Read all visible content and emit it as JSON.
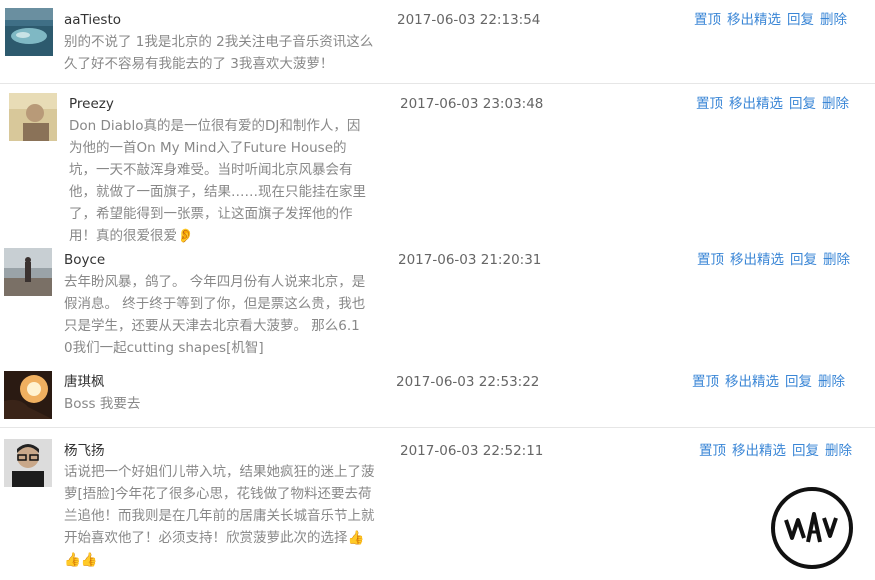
{
  "actions": {
    "pin": "置顶",
    "unfeature": "移出精选",
    "reply": "回复",
    "delete": "删除"
  },
  "comments": [
    {
      "username": "aaTiesto",
      "text": "别的不说了 1我是北京的 2我关注电子音乐资讯这么久了好不容易有我能去的了 3我喜欢大菠萝！",
      "time": "2017-06-03 22:13:54",
      "avatar_icon": "landscape-avatar"
    },
    {
      "username": "Preezy",
      "text": "Don Diablo真的是一位很有爱的DJ和制作人，因为他的一首On My Mind入了Future House的坑，一天不敲浑身难受。当时听闻北京风暴会有他，就做了一面旗子，结果……现在只能挂在家里了，希望能得到一张票，让这面旗子发挥他的作用！真的很爱很爱👂",
      "time": "2017-06-03 23:03:48",
      "avatar_icon": "person-avatar"
    },
    {
      "username": "Boyce",
      "text": "去年盼风暴，鸽了。 今年四月份有人说来北京，是假消息。 终于终于等到了你，但是票这么贵，我也只是学生，还要从天津去北京看大菠萝。 那么6.10我们一起cutting shapes[机智]",
      "time": "2017-06-03 21:20:31",
      "avatar_icon": "beach-avatar"
    },
    {
      "username": "唐琪枫",
      "text": "Boss 我要去",
      "time": "2017-06-03 22:53:22",
      "avatar_icon": "sunset-avatar"
    },
    {
      "username": "杨飞扬",
      "text": "话说把一个好姐们儿带入坑，结果她疯狂的迷上了菠萝[捂脸]今年花了很多心思，花钱做了物料还要去荷兰追他！而我则是在几年前的居庸关长城音乐节上就开始喜欢他了！必须支持！欣赏菠萝此次的选择👍👍👍",
      "time": "2017-06-03 22:52:11",
      "avatar_icon": "glasses-person-avatar"
    }
  ]
}
